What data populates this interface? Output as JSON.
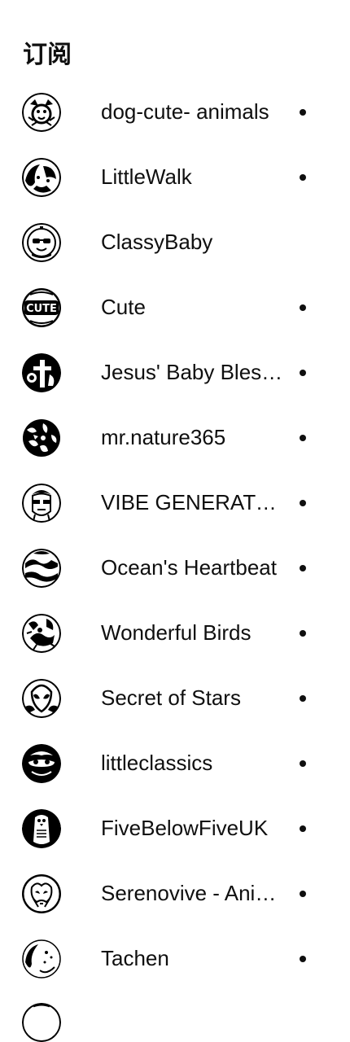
{
  "section": {
    "title": "订阅"
  },
  "subscriptions": [
    {
      "name": "dog-cute- animals",
      "avatar": "dog-avatar-icon",
      "new_content": true
    },
    {
      "name": "LittleWalk",
      "avatar": "children-avatar-icon",
      "new_content": true
    },
    {
      "name": "ClassyBaby",
      "avatar": "baby-sunglasses-avatar-icon",
      "new_content": false
    },
    {
      "name": "Cute",
      "avatar": "cute-logo-avatar-icon",
      "new_content": true
    },
    {
      "name": "Jesus' Baby Bles…",
      "avatar": "cross-avatar-icon",
      "new_content": true
    },
    {
      "name": "mr.nature365",
      "avatar": "nature-avatar-icon",
      "new_content": true
    },
    {
      "name": "VIBE GENERATOR",
      "avatar": "face-sunglasses-avatar-icon",
      "new_content": true
    },
    {
      "name": "Ocean's Heartbeat",
      "avatar": "ocean-avatar-icon",
      "new_content": true
    },
    {
      "name": "Wonderful Birds",
      "avatar": "bird-avatar-icon",
      "new_content": true
    },
    {
      "name": "Secret of Stars",
      "avatar": "alien-avatar-icon",
      "new_content": true
    },
    {
      "name": "littleclassics",
      "avatar": "cartoon-avatar-icon",
      "new_content": true
    },
    {
      "name": "FiveBelowFiveUK",
      "avatar": "penguin-avatar-icon",
      "new_content": true
    },
    {
      "name": "Serenovive - Ani…",
      "avatar": "animal-avatar-icon",
      "new_content": true
    },
    {
      "name": "Tachen",
      "avatar": "cat-avatar-icon",
      "new_content": true
    }
  ],
  "colors": {
    "background": "#ffffff",
    "text": "#0f0f0f",
    "dot": "#0f0f0f"
  }
}
